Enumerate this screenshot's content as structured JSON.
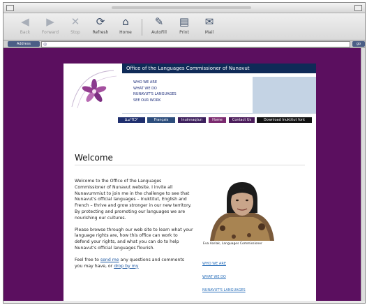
{
  "toolbar": {
    "buttons": [
      {
        "label": "Back",
        "icon": "left-arrow-icon"
      },
      {
        "label": "Forward",
        "icon": "right-arrow-icon"
      },
      {
        "label": "Stop",
        "icon": "close-icon"
      },
      {
        "label": "Refresh",
        "icon": "refresh-icon"
      },
      {
        "label": "Home",
        "icon": "home-icon"
      },
      {
        "label": "AutoFill",
        "icon": "autofill-icon"
      },
      {
        "label": "Print",
        "icon": "print-icon"
      },
      {
        "label": "Mail",
        "icon": "mail-icon"
      }
    ]
  },
  "address": {
    "label": "Address",
    "url": "",
    "go": "go"
  },
  "site": {
    "title": "Office of the Languages Commissioner of Nunavut",
    "nav": [
      "WHO WE ARE",
      "WHAT WE DO",
      "NUNAVUT'S LANGUAGES",
      "SEE OUR WORK"
    ],
    "languages": [
      {
        "label": "ᐃᓄᒃᑎᑐᑦ",
        "color": "#1f2f6e"
      },
      {
        "label": "Français",
        "color": "#2d4d7c"
      },
      {
        "label": "Inuinnaqtun",
        "color": "#3c1f5c"
      },
      {
        "label": "Home",
        "color": "#7a2a6f"
      },
      {
        "label": "Contact Us",
        "color": "#4a1c5a"
      },
      {
        "label": "Download Inuktitut font",
        "color": "#111111"
      }
    ],
    "heading": "Welcome",
    "paragraphs": {
      "p1": "Welcome to the Office of the Languages Commissioner of Nunavut website. I invite all Nunavummiut to join me in the challenge to see that Nunavut's official languages – Inuktitut, English and French – thrive and grow stronger in our new territory. By protecting and promoting our languages we are nourishing our cultures.",
      "p2": "Please browse through our web site to learn what your language rights are, how this office can work to defend your rights, and what you can do to help Nunavut's official languages flourish.",
      "p3_a": "Feel free to ",
      "p3_link": "send me",
      "p3_b": " any questions and comments you may have, or ",
      "p3_link2": "drop by my"
    },
    "caption": "Eva Aariak, Languages Commissioner",
    "side_links": [
      "WHO WE ARE",
      "WHAT WE DO",
      "NUNAVUT'S LANGUAGES"
    ],
    "colors": {
      "background": "#5b0f5f",
      "banner": "#0f2a57",
      "accent_box": "#c4d3e4"
    }
  }
}
